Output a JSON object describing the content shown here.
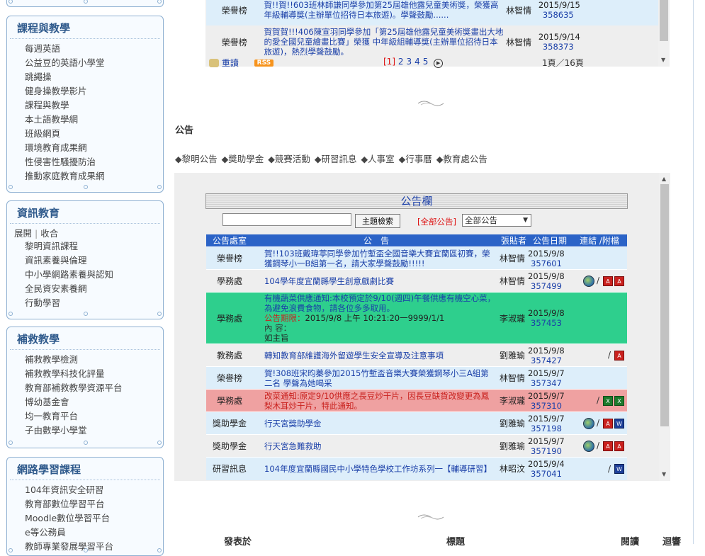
{
  "sidebar": [
    {
      "title": "課程與教學",
      "items": [
        "每週英語",
        "公益豆的英語小學堂",
        "跳繩操",
        "健身操教學影片",
        "課程與教學",
        "本土語教學網",
        "班級網頁",
        "環境教育成果網",
        "性侵害性騷擾防治",
        "推動家庭教育成果網"
      ]
    },
    {
      "title": "資訊教育",
      "toggle_expand": "展開",
      "toggle_sep": " | ",
      "toggle_collapse": "收合",
      "items": [
        "黎明資訊課程",
        "資訊素養與倫理",
        "中小學網路素養與認知",
        "全民資安素養網",
        "行動學習"
      ]
    },
    {
      "title": "補救教學",
      "items": [
        "補救教學檢測",
        "補救教學科技化評量",
        "教育部補救教學資源平台",
        "博幼基金會",
        "均一教育平台",
        "子由數學小學堂"
      ]
    },
    {
      "title": "網路學習課程",
      "items": [
        "104年資訊安全研習",
        "教育部數位學習平台",
        "Moodle數位學習平台",
        "e等公務員",
        "教師專業發展學習平台"
      ]
    }
  ],
  "honor": {
    "rows": [
      {
        "category": "榮譽榜",
        "title": "賀!!賀!!603班林師謙同學參加第25屆雄他露兒童美術獎，榮獲高年級輔導獎(主辦單位招待日本旅遊)。學聲鼓勵......",
        "poster": "林智情",
        "date": "2015/9/15",
        "id": "358635"
      },
      {
        "category": "榮譽榜",
        "title": "賀賀賀!!!406陳宣羽同學參加「第25屆雄他露兒童美術獎畫出大地的愛全國兒童繪畫比賽」榮獲 中年級組輔導獎(主辦單位招待日本旅遊)，熱烈學聲鼓勵。",
        "poster": "林智情",
        "date": "2015/9/14",
        "id": "358373"
      }
    ],
    "reload": "重讀",
    "rss": "RSS",
    "pages_current": "[1]",
    "pages": [
      "2",
      "3",
      "4",
      "5"
    ],
    "page_info": "1頁／16頁"
  },
  "announce_heading": "公告",
  "announce_links": [
    "◆黎明公告",
    "◆獎助學金",
    "◆競賽活動",
    "◆研習訊息",
    "◆人事室",
    "◆行事曆",
    "◆教育處公告"
  ],
  "board": {
    "title": "公告欄",
    "search_placeholder": "",
    "search_button": "主題檢索",
    "filter_label": "[全部公告]",
    "filter_value": "全部公告",
    "headers": [
      "公告處室",
      "公　告",
      "張貼者",
      "公告日期",
      "連結 /附檔"
    ],
    "rows": [
      {
        "category": "榮譽榜",
        "title": "賀!!103班戴瑋葶同學參加竹塹盃全國音樂大賽宜蘭區初賽，榮獲鋼琴小一B組第一名，請大家學聲鼓勵!!!!!",
        "poster": "林智情",
        "date": "2015/9/8",
        "id": "357601",
        "attach": "",
        "bg": "#ddeefa"
      },
      {
        "category": "學務處",
        "title": "104學年度宜蘭縣學生創意戲劇比賽",
        "poster": "林智情",
        "date": "2015/9/8",
        "id": "357499",
        "attach": "globe,pdf,pdf",
        "bg": "#eeeeee"
      },
      {
        "category": "學務處",
        "title": "有機蔬菜供應通知:本校預定於9/10(週四)午餐供應有機空心菜，為避免浪費食物，請各位多多取用。",
        "period_label": "公告期限：",
        "period": "2015/9/8 上午 10:21:20一9999/1/1",
        "content_label": "內 容：",
        "content": "如主旨",
        "poster": "李淑瓏",
        "date": "2015/9/8",
        "id": "357453",
        "attach": "",
        "bg": "#2ecf8d"
      },
      {
        "category": "教務處",
        "title": "轉知教育部維護海外留遊學生安全宣導及注意事項",
        "poster": "劉雅瑜",
        "date": "2015/9/8",
        "id": "357427",
        "attach": "pdf",
        "bg": "#eeeeee"
      },
      {
        "category": "榮譽榜",
        "title": "賀!308班宋昀蓁參加2015竹塹盃音樂大賽榮獲鋼琴小三A組第二名 學聲為她喝采",
        "poster": "林智情",
        "date": "2015/9/7",
        "id": "357347",
        "attach": "",
        "bg": "#ddeefa"
      },
      {
        "category": "學務處",
        "title": "改菜通知:原定9/10供應之長豆炒干片，因長豆缺貨改變更為鳳梨木耳炒干片，特此通知。",
        "poster": "李淑瓏",
        "date": "2015/9/7",
        "id": "357310",
        "attach": "xls,xls",
        "bg": "#efa1a1"
      },
      {
        "category": "獎助學金",
        "title": "行天宮獎助學金",
        "poster": "劉雅瑜",
        "date": "2015/9/7",
        "id": "357198",
        "attach": "globe,pdf,doc",
        "bg": "#ddeefa"
      },
      {
        "category": "獎助學金",
        "title": "行天宮急難救助",
        "poster": "劉雅瑜",
        "date": "2015/9/7",
        "id": "357190",
        "attach": "globe,pdf,pdf",
        "bg": "#eeeeee"
      },
      {
        "category": "研習訊息",
        "title": "104年度宜蘭縣國民中小學特色學校工作坊系列一【輔導研習】",
        "poster": "林昭汶",
        "date": "2015/9/4",
        "id": "357041",
        "attach": "doc",
        "bg": "#ddeefa"
      }
    ]
  },
  "bottom_headers": [
    "發表於",
    "標題",
    "閱讀",
    "迴響"
  ],
  "colors": {
    "accent": "#1a3fa8",
    "sidebar_border": "#8eb0d2",
    "highlight_green": "#2ecf8d",
    "highlight_red": "#efa1a1",
    "row_blue": "#ddeefa"
  }
}
